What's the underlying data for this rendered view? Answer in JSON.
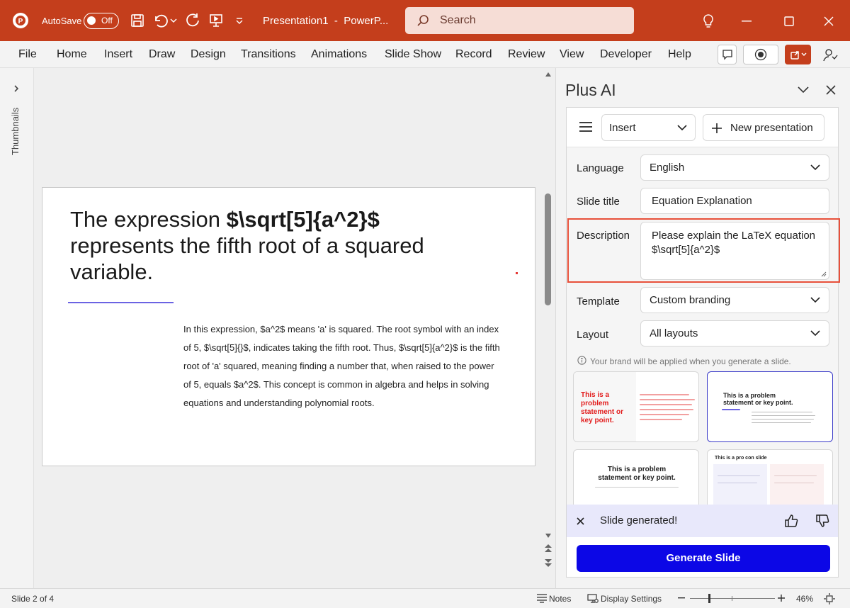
{
  "titlebar": {
    "app_icon": "powerpoint-logo",
    "autosave_label": "AutoSave",
    "autosave_state": "Off",
    "document_title": "Presentation1  -  PowerP...",
    "search_placeholder": "Search",
    "accent_color": "#c43e1c"
  },
  "menu": {
    "items": [
      "File",
      "Home",
      "Insert",
      "Draw",
      "Design",
      "Transitions",
      "Animations",
      "Slide Show",
      "Record",
      "Review",
      "View",
      "Developer",
      "Help"
    ]
  },
  "thumbnails": {
    "label": "Thumbnails"
  },
  "slide": {
    "title": "The expression $\\sqrt[5]{a^2}$ represents the fifth root of a squared variable.",
    "title_pre": "The expression ",
    "title_math": "$\\sqrt[5]{a^2}$",
    "title_post": "represents the fifth root of a squared variable.",
    "body": "In this expression, $a^2$ means 'a' is squared. The root symbol with an index of 5, $\\sqrt[5]{}$, indicates taking the fifth root. Thus, $\\sqrt[5]{a^2}$ is the fifth root of 'a' squared, meaning finding a number that, when raised to the power of 5, equals $a^2$. This concept is common in algebra and helps in solving equations and understanding polynomial roots.",
    "accent_line_color": "#6b63e3"
  },
  "panel": {
    "title": "Plus AI",
    "insert_label": "Insert",
    "new_presentation_label": "New presentation",
    "language_label": "Language",
    "language_value": "English",
    "slide_title_label": "Slide title",
    "slide_title_value": "Equation Explanation",
    "description_label": "Description",
    "description_value": "Please explain the LaTeX equation $\\sqrt[5]{a^2}$",
    "template_label": "Template",
    "template_value": "Custom branding",
    "layout_label": "Layout",
    "layout_value": "All layouts",
    "brand_note": "Your brand will be applied when you generate a slide.",
    "thumbs": [
      {
        "text": "This is a problem statement or key point."
      },
      {
        "text": "This is a problem statement or key point."
      },
      {
        "text": "This is a problem statement or key point."
      },
      {
        "text": "This is a pro con slide"
      }
    ],
    "toast": "Slide generated!",
    "generate_label": "Generate Slide",
    "generate_color": "#0c07e6",
    "highlight_color": "#e8503a"
  },
  "status": {
    "slide_indicator": "Slide 2 of 4",
    "notes_label": "Notes",
    "display_settings_label": "Display Settings",
    "zoom": "46%"
  }
}
